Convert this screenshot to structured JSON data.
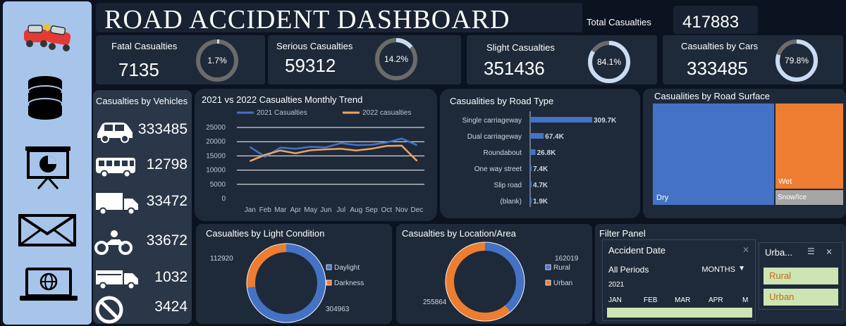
{
  "title": "ROAD ACCIDENT DASHBOARD",
  "total": {
    "label": "Total Casualties",
    "value": "417883"
  },
  "kpis": [
    {
      "label": "Fatal Casualties",
      "value": "7135",
      "pct_label": "1.7%",
      "pct": 1.7
    },
    {
      "label": "Serious Casualties",
      "value": "59312",
      "pct_label": "14.2%",
      "pct": 14.2
    },
    {
      "label": "Slight Casualties",
      "value": "351436",
      "pct_label": "84.1%",
      "pct": 84.1
    },
    {
      "label": "Casualties by Cars",
      "value": "333485",
      "pct_label": "79.8%",
      "pct": 79.8
    }
  ],
  "nav_icons": [
    "crash-cars-icon",
    "database-icon",
    "presentation-icon",
    "mail-icon",
    "laptop-globe-icon"
  ],
  "vehicles": {
    "title": "Casualties by Vehicles",
    "items": [
      {
        "icon": "car-icon",
        "value": "333485"
      },
      {
        "icon": "bus-icon",
        "value": "12798"
      },
      {
        "icon": "truck-icon",
        "value": "33472"
      },
      {
        "icon": "motorcycle-icon",
        "value": "33672"
      },
      {
        "icon": "van-icon",
        "value": "1032"
      },
      {
        "icon": "no-entry-icon",
        "value": "3424"
      }
    ]
  },
  "chart_data": [
    {
      "type": "line",
      "title": "2021 vs 2022 Casualties Monthly Trend",
      "categories": [
        "Jan",
        "Feb",
        "Mar",
        "Apr",
        "May",
        "Jun",
        "Jul",
        "Aug",
        "Sep",
        "Oct",
        "Nov",
        "Dec"
      ],
      "ylim": [
        0,
        25000
      ],
      "yticks": [
        0,
        5000,
        10000,
        15000,
        20000,
        25000
      ],
      "series": [
        {
          "name": "2021 Casualties",
          "color": "#4472c4",
          "values": [
            18100,
            14700,
            17900,
            17500,
            18200,
            18000,
            19500,
            18800,
            18900,
            19700,
            21100,
            18800
          ]
        },
        {
          "name": "2022 casualties",
          "color": "#f4a261",
          "values": [
            13200,
            15400,
            16900,
            15900,
            17000,
            17300,
            17500,
            16900,
            17500,
            18500,
            18600,
            13300
          ]
        }
      ],
      "legend": "top"
    },
    {
      "type": "bar",
      "title": "Casualities by Road Type",
      "orientation": "horizontal",
      "categories": [
        "Single carriageway",
        "Dual carriageway",
        "Roundabout",
        "One way street",
        "Slip road",
        "(blank)"
      ],
      "values": [
        309700,
        67400,
        26800,
        7400,
        4700,
        1900
      ],
      "labels": [
        "309.7K",
        "67.4K",
        "26.8K",
        "7.4K",
        "4.7K",
        "1.9K"
      ],
      "color": "#4472c4"
    },
    {
      "type": "treemap",
      "title": "Casualities by Road  Surface",
      "categories": [
        "Dry",
        "Wet",
        "Snow/Ice"
      ],
      "colors": [
        "#4472c4",
        "#ed7d31",
        "#a5a5a5"
      ]
    },
    {
      "type": "pie",
      "title": "Casualties by Light Condition",
      "categories": [
        "Daylight",
        "Darkness"
      ],
      "values": [
        304963,
        112920
      ],
      "colors": [
        "#4472c4",
        "#ed7d31"
      ],
      "legend": "right"
    },
    {
      "type": "pie",
      "title": "Casualties by Location/Area",
      "categories": [
        "Rural",
        "Urban"
      ],
      "values": [
        162019,
        255864
      ],
      "colors": [
        "#4472c4",
        "#ed7d31"
      ],
      "legend": "right"
    }
  ],
  "filter": {
    "title": "Filter Panel",
    "date_header": "Accident Date",
    "all_periods": "All Periods",
    "months": "MONTHS",
    "year": "2021",
    "month_labels": [
      "JAN",
      "FEB",
      "MAR",
      "APR",
      "M"
    ],
    "area_header": "Urba...",
    "area_options": [
      "Rural",
      "Urban"
    ]
  }
}
